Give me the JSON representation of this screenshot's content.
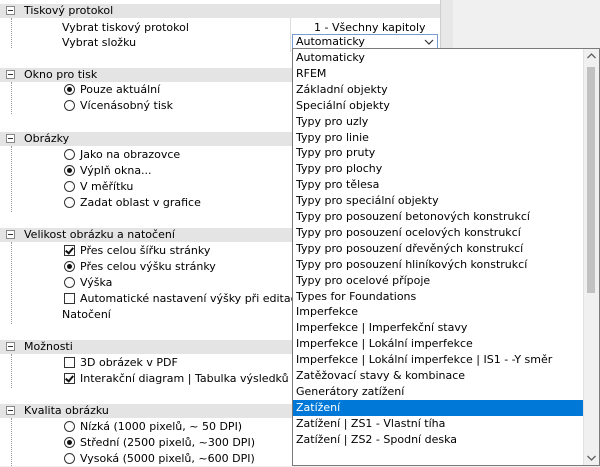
{
  "sections": {
    "tiskovy_protokol": {
      "title": "Tiskový protokol",
      "rows": [
        {
          "label": "Vybrat tiskový protokol",
          "value": "1 - Všechny kapitoly"
        },
        {
          "label": "Vybrat složku",
          "value": "Automaticky"
        }
      ]
    },
    "okno_pro_tisk": {
      "title": "Okno pro tisk",
      "options": [
        {
          "label": "Pouze aktuální",
          "checked": true
        },
        {
          "label": "Vícenásobný tisk",
          "checked": false
        }
      ]
    },
    "obrazky": {
      "title": "Obrázky",
      "options": [
        {
          "label": "Jako na obrazovce",
          "checked": false
        },
        {
          "label": "Výplň okna...",
          "checked": true
        },
        {
          "label": "V měřítku",
          "checked": false
        },
        {
          "label": "Zadat oblast v grafice",
          "checked": false
        }
      ]
    },
    "velikost": {
      "title": "Velikost obrázku a natočení",
      "items": [
        {
          "type": "check",
          "label": "Přes celou šířku stránky",
          "checked": true
        },
        {
          "type": "radio",
          "label": "Přes celou výšku stránky",
          "checked": true
        },
        {
          "type": "radio",
          "label": "Výška",
          "checked": false
        },
        {
          "type": "check",
          "label": "Automatické nastavení výšky při editaci",
          "checked": false
        }
      ],
      "natoceni": "Natočení"
    },
    "moznosti": {
      "title": "Možnosti",
      "items": [
        {
          "label": "3D obrázek v PDF",
          "checked": false
        },
        {
          "label": "Interakční diagram | Tabulka výsledků",
          "checked": true
        }
      ]
    },
    "kvalita": {
      "title": "Kvalita obrázku",
      "options": [
        {
          "label": "Nízká (1000 pixelů, ~ 50 DPI)",
          "checked": false
        },
        {
          "label": "Střední (2500 pixelů, ~300 DPI)",
          "checked": true
        },
        {
          "label": "Vysoká (5000 pixelů, ~600 DPI)",
          "checked": false
        }
      ]
    }
  },
  "dropdown": {
    "selected_index": 22,
    "options": [
      "Automaticky",
      "RFEM",
      "Základní objekty",
      "Speciální objekty",
      "Typy pro uzly",
      "Typy pro linie",
      "Typy pro pruty",
      "Typy pro plochy",
      "Typy pro tělesa",
      "Typy pro speciální objekty",
      "Typy pro posouzení betonových konstrukcí",
      "Typy pro posouzení ocelových konstrukcí",
      "Typy pro posouzení dřevěných konstrukcí",
      "Typy pro posouzení hliníkových konstrukcí",
      "Typy pro ocelové přípoje",
      "Types for Foundations",
      "Imperfekce",
      "Imperfekce | Imperfekční stavy",
      "Imperfekce | Lokální imperfekce",
      "Imperfekce | Lokální imperfekce | IS1 - -Y směr",
      "Zatěžovací stavy & kombinace",
      "Generátory zatížení",
      "Zatížení",
      "Zatížení | ZS1 - Vlastní tíha",
      "Zatížení | ZS2 - Spodní deska"
    ]
  },
  "colors": {
    "selection": "#0078d7",
    "section_header": "#e4e4e4"
  }
}
